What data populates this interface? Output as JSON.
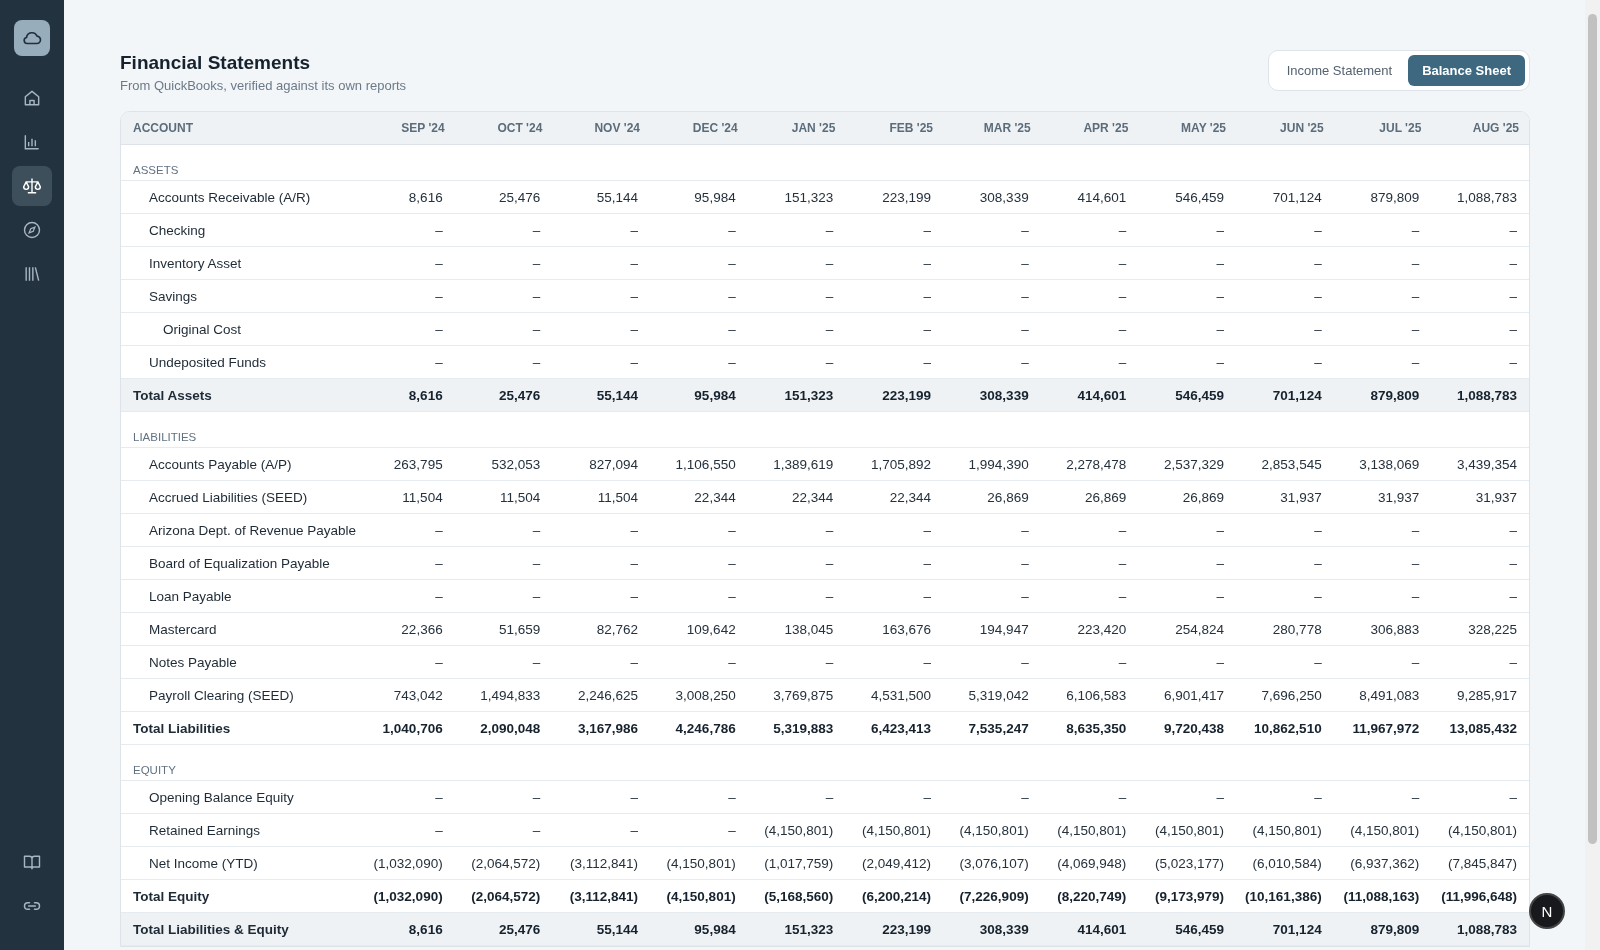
{
  "sidebar": {
    "items": [
      {
        "selected": false
      },
      {
        "selected": false
      },
      {
        "selected": true
      },
      {
        "selected": false
      },
      {
        "selected": false
      }
    ],
    "bottom_items": [
      {
        "selected": false
      },
      {
        "selected": false
      }
    ]
  },
  "header": {
    "title": "Financial Statements",
    "subtitle": "From QuickBooks, verified against its own reports"
  },
  "tabs": [
    {
      "label": "Income Statement",
      "selected": false
    },
    {
      "label": "Balance Sheet",
      "selected": true
    }
  ],
  "table": {
    "columns": [
      "ACCOUNT",
      "SEP '24",
      "OCT '24",
      "NOV '24",
      "DEC '24",
      "JAN '25",
      "FEB '25",
      "MAR '25",
      "APR '25",
      "MAY '25",
      "JUN '25",
      "JUL '25",
      "AUG '25"
    ],
    "rows": [
      {
        "kind": "section",
        "label": "ASSETS"
      },
      {
        "kind": "account",
        "label": "Accounts Receivable (A/R)",
        "values": [
          "8,616",
          "25,476",
          "55,144",
          "95,984",
          "151,323",
          "223,199",
          "308,339",
          "414,601",
          "546,459",
          "701,124",
          "879,809",
          "1,088,783"
        ]
      },
      {
        "kind": "account",
        "label": "Checking",
        "values": [
          "–",
          "–",
          "–",
          "–",
          "–",
          "–",
          "–",
          "–",
          "–",
          "–",
          "–",
          "–"
        ]
      },
      {
        "kind": "account",
        "label": "Inventory Asset",
        "values": [
          "–",
          "–",
          "–",
          "–",
          "–",
          "–",
          "–",
          "–",
          "–",
          "–",
          "–",
          "–"
        ]
      },
      {
        "kind": "account",
        "label": "Savings",
        "values": [
          "–",
          "–",
          "–",
          "–",
          "–",
          "–",
          "–",
          "–",
          "–",
          "–",
          "–",
          "–"
        ]
      },
      {
        "kind": "subaccount",
        "label": "Original Cost",
        "values": [
          "–",
          "–",
          "–",
          "–",
          "–",
          "–",
          "–",
          "–",
          "–",
          "–",
          "–",
          "–"
        ]
      },
      {
        "kind": "account",
        "label": "Undeposited Funds",
        "values": [
          "–",
          "–",
          "–",
          "–",
          "–",
          "–",
          "–",
          "–",
          "–",
          "–",
          "–",
          "–"
        ]
      },
      {
        "kind": "total",
        "shaded": true,
        "label": "Total Assets",
        "values": [
          "8,616",
          "25,476",
          "55,144",
          "95,984",
          "151,323",
          "223,199",
          "308,339",
          "414,601",
          "546,459",
          "701,124",
          "879,809",
          "1,088,783"
        ]
      },
      {
        "kind": "section",
        "label": "LIABILITIES"
      },
      {
        "kind": "account",
        "label": "Accounts Payable (A/P)",
        "values": [
          "263,795",
          "532,053",
          "827,094",
          "1,106,550",
          "1,389,619",
          "1,705,892",
          "1,994,390",
          "2,278,478",
          "2,537,329",
          "2,853,545",
          "3,138,069",
          "3,439,354"
        ]
      },
      {
        "kind": "account",
        "label": "Accrued Liabilities (SEED)",
        "values": [
          "11,504",
          "11,504",
          "11,504",
          "22,344",
          "22,344",
          "22,344",
          "26,869",
          "26,869",
          "26,869",
          "31,937",
          "31,937",
          "31,937"
        ]
      },
      {
        "kind": "account",
        "label": "Arizona Dept. of Revenue Payable",
        "values": [
          "–",
          "–",
          "–",
          "–",
          "–",
          "–",
          "–",
          "–",
          "–",
          "–",
          "–",
          "–"
        ]
      },
      {
        "kind": "account",
        "label": "Board of Equalization Payable",
        "values": [
          "–",
          "–",
          "–",
          "–",
          "–",
          "–",
          "–",
          "–",
          "–",
          "–",
          "–",
          "–"
        ]
      },
      {
        "kind": "account",
        "label": "Loan Payable",
        "values": [
          "–",
          "–",
          "–",
          "–",
          "–",
          "–",
          "–",
          "–",
          "–",
          "–",
          "–",
          "–"
        ]
      },
      {
        "kind": "account",
        "label": "Mastercard",
        "values": [
          "22,366",
          "51,659",
          "82,762",
          "109,642",
          "138,045",
          "163,676",
          "194,947",
          "223,420",
          "254,824",
          "280,778",
          "306,883",
          "328,225"
        ]
      },
      {
        "kind": "account",
        "label": "Notes Payable",
        "values": [
          "–",
          "–",
          "–",
          "–",
          "–",
          "–",
          "–",
          "–",
          "–",
          "–",
          "–",
          "–"
        ]
      },
      {
        "kind": "account",
        "label": "Payroll Clearing (SEED)",
        "values": [
          "743,042",
          "1,494,833",
          "2,246,625",
          "3,008,250",
          "3,769,875",
          "4,531,500",
          "5,319,042",
          "6,106,583",
          "6,901,417",
          "7,696,250",
          "8,491,083",
          "9,285,917"
        ]
      },
      {
        "kind": "total",
        "shaded": false,
        "label": "Total Liabilities",
        "values": [
          "1,040,706",
          "2,090,048",
          "3,167,986",
          "4,246,786",
          "5,319,883",
          "6,423,413",
          "7,535,247",
          "8,635,350",
          "9,720,438",
          "10,862,510",
          "11,967,972",
          "13,085,432"
        ]
      },
      {
        "kind": "section",
        "label": "EQUITY"
      },
      {
        "kind": "account",
        "label": "Opening Balance Equity",
        "values": [
          "–",
          "–",
          "–",
          "–",
          "–",
          "–",
          "–",
          "–",
          "–",
          "–",
          "–",
          "–"
        ]
      },
      {
        "kind": "account",
        "label": "Retained Earnings",
        "values": [
          "–",
          "–",
          "–",
          "–",
          "(4,150,801)",
          "(4,150,801)",
          "(4,150,801)",
          "(4,150,801)",
          "(4,150,801)",
          "(4,150,801)",
          "(4,150,801)",
          "(4,150,801)"
        ]
      },
      {
        "kind": "account",
        "label": "Net Income (YTD)",
        "values": [
          "(1,032,090)",
          "(2,064,572)",
          "(3,112,841)",
          "(4,150,801)",
          "(1,017,759)",
          "(2,049,412)",
          "(3,076,107)",
          "(4,069,948)",
          "(5,023,177)",
          "(6,010,584)",
          "(6,937,362)",
          "(7,845,847)"
        ]
      },
      {
        "kind": "total",
        "shaded": false,
        "label": "Total Equity",
        "values": [
          "(1,032,090)",
          "(2,064,572)",
          "(3,112,841)",
          "(4,150,801)",
          "(5,168,560)",
          "(6,200,214)",
          "(7,226,909)",
          "(8,220,749)",
          "(9,173,979)",
          "(10,161,386)",
          "(11,088,163)",
          "(11,996,648)"
        ]
      },
      {
        "kind": "total",
        "shaded": true,
        "label": "Total Liabilities & Equity",
        "values": [
          "8,616",
          "25,476",
          "55,144",
          "95,984",
          "151,323",
          "223,199",
          "308,339",
          "414,601",
          "546,459",
          "701,124",
          "879,809",
          "1,088,783"
        ]
      }
    ]
  },
  "dev_badge": {
    "label": "N"
  }
}
